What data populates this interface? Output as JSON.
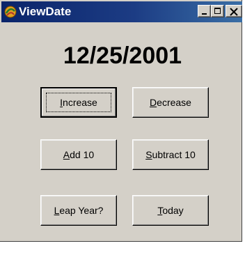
{
  "window": {
    "title": "ViewDate",
    "controls": [
      "minimize-icon",
      "maximize-icon",
      "close-icon"
    ],
    "title_bar_color": "#0a246a",
    "face_color": "#d4d0c8"
  },
  "date_display": "12/25/2001",
  "buttons": {
    "increase": {
      "mnemonic": "I",
      "rest": "ncrease"
    },
    "decrease": {
      "mnemonic": "D",
      "rest": "ecrease"
    },
    "add10": {
      "mnemonic": "A",
      "rest": "dd 10"
    },
    "subtract10": {
      "mnemonic": "S",
      "rest": "ubtract 10"
    },
    "leapyear": {
      "mnemonic": "L",
      "rest": "eap Year?"
    },
    "today": {
      "mnemonic": "T",
      "rest": "oday"
    }
  }
}
